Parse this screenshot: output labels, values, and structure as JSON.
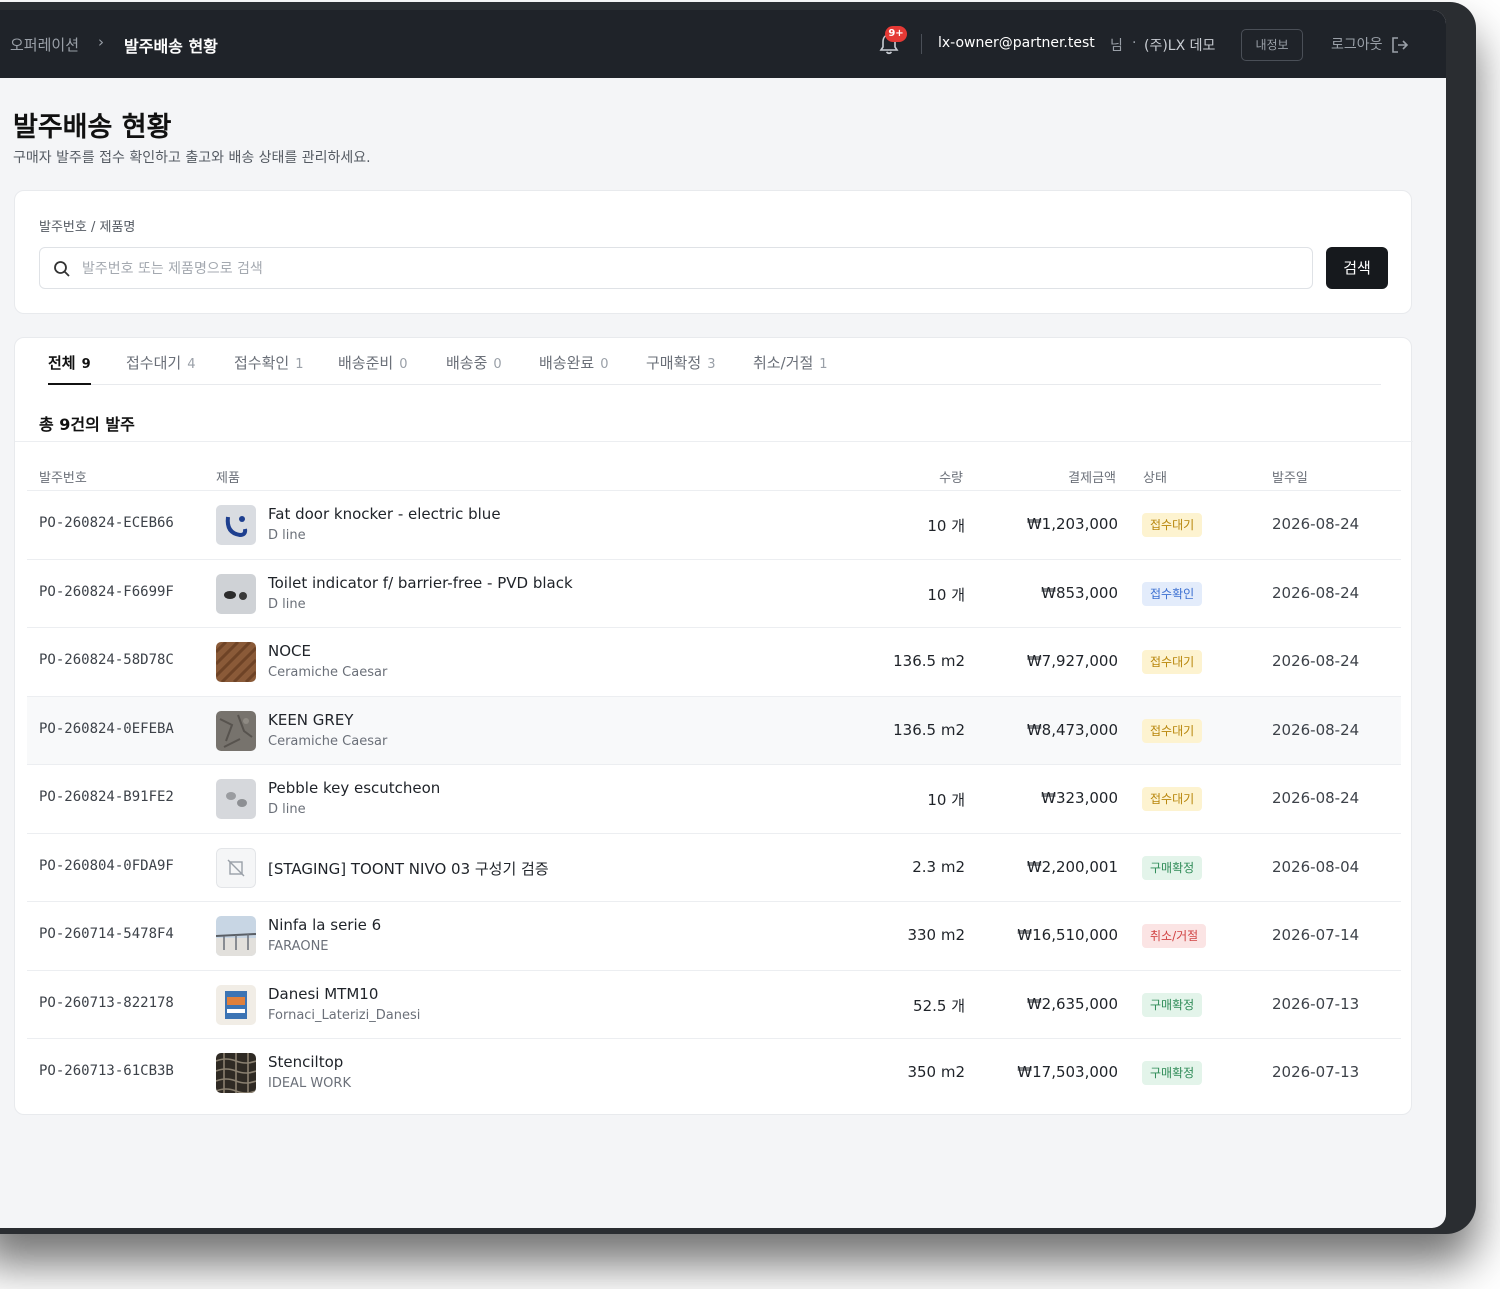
{
  "topbar": {
    "breadcrumb_parent": "오퍼레이션",
    "breadcrumb_sep": "›",
    "breadcrumb_current": "발주배송 현황",
    "notification_badge": "9+",
    "user_email": "lx-owner@partner.test",
    "user_suffix": "님",
    "user_dot": "·",
    "user_company": "(주)LX 데모",
    "my_info_label": "내정보",
    "logout_label": "로그아웃"
  },
  "page": {
    "title": "발주배송 현황",
    "description": "구매자 발주를 접수 확인하고 출고와 배송 상태를 관리하세요."
  },
  "search": {
    "label": "발주번호 / 제품명",
    "placeholder": "발주번호 또는 제품명으로 검색",
    "value": "",
    "button_label": "검색"
  },
  "tabs": [
    {
      "label": "전체",
      "count": "9",
      "active": true
    },
    {
      "label": "접수대기",
      "count": "4",
      "active": false
    },
    {
      "label": "접수확인",
      "count": "1",
      "active": false
    },
    {
      "label": "배송준비",
      "count": "0",
      "active": false
    },
    {
      "label": "배송중",
      "count": "0",
      "active": false
    },
    {
      "label": "배송완료",
      "count": "0",
      "active": false
    },
    {
      "label": "구매확정",
      "count": "3",
      "active": false
    },
    {
      "label": "취소/거절",
      "count": "1",
      "active": false
    }
  ],
  "total_label": "총 9건의 발주",
  "columns": {
    "po": "발주번호",
    "product": "제품",
    "qty": "수량",
    "amount": "결제금액",
    "status": "상태",
    "date": "발주일"
  },
  "status_colors": {
    "접수대기": {
      "bg": "#fdf3d0",
      "fg": "#b8860b"
    },
    "접수확인": {
      "bg": "#e3ecfb",
      "fg": "#3b6fd1"
    },
    "구매확정": {
      "bg": "#e3f4ea",
      "fg": "#2e8b57"
    },
    "취소/거절": {
      "bg": "#fbe4e4",
      "fg": "#d14343"
    }
  },
  "orders": [
    {
      "po": "PO-260824-ECEB66",
      "name": "Fat door knocker - electric blue",
      "brand": "D line",
      "qty": "10 개",
      "amount": "₩1,203,000",
      "status": "접수대기",
      "date": "2026-08-24",
      "thumb": "door-knocker-icon"
    },
    {
      "po": "PO-260824-F6699F",
      "name": "Toilet indicator f/ barrier-free - PVD black",
      "brand": "D line",
      "qty": "10 개",
      "amount": "₩853,000",
      "status": "접수확인",
      "date": "2026-08-24",
      "thumb": "toilet-indicator-icon"
    },
    {
      "po": "PO-260824-58D78C",
      "name": "NOCE",
      "brand": "Ceramiche Caesar",
      "qty": "136.5 m2",
      "amount": "₩7,927,000",
      "status": "접수대기",
      "date": "2026-08-24",
      "thumb": "wood-tile-icon"
    },
    {
      "po": "PO-260824-0EFEBA",
      "name": "KEEN GREY",
      "brand": "Ceramiche Caesar",
      "qty": "136.5 m2",
      "amount": "₩8,473,000",
      "status": "접수대기",
      "date": "2026-08-24",
      "thumb": "stone-tile-icon"
    },
    {
      "po": "PO-260824-B91FE2",
      "name": "Pebble key escutcheon",
      "brand": "D line",
      "qty": "10 개",
      "amount": "₩323,000",
      "status": "접수대기",
      "date": "2026-08-24",
      "thumb": "escutcheon-icon"
    },
    {
      "po": "PO-260804-0FDA9F",
      "name": "[STAGING] TOONT NIVO 03 구성기 검증",
      "brand": "",
      "qty": "2.3 m2",
      "amount": "₩2,200,001",
      "status": "구매확정",
      "date": "2026-08-04",
      "thumb": "no-image-icon"
    },
    {
      "po": "PO-260714-5478F4",
      "name": "Ninfa la serie 6",
      "brand": "FARAONE",
      "qty": "330 m2",
      "amount": "₩16,510,000",
      "status": "취소/거절",
      "date": "2026-07-14",
      "thumb": "railing-icon"
    },
    {
      "po": "PO-260713-822178",
      "name": "Danesi MTM10",
      "brand": "Fornaci_Laterizi_Danesi",
      "qty": "52.5 개",
      "amount": "₩2,635,000",
      "status": "구매확정",
      "date": "2026-07-13",
      "thumb": "brick-package-icon"
    },
    {
      "po": "PO-260713-61CB3B",
      "name": "Stenciltop",
      "brand": "IDEAL WORK",
      "qty": "350 m2",
      "amount": "₩17,503,000",
      "status": "구매확정",
      "date": "2026-07-13",
      "thumb": "stencil-pattern-icon"
    }
  ]
}
